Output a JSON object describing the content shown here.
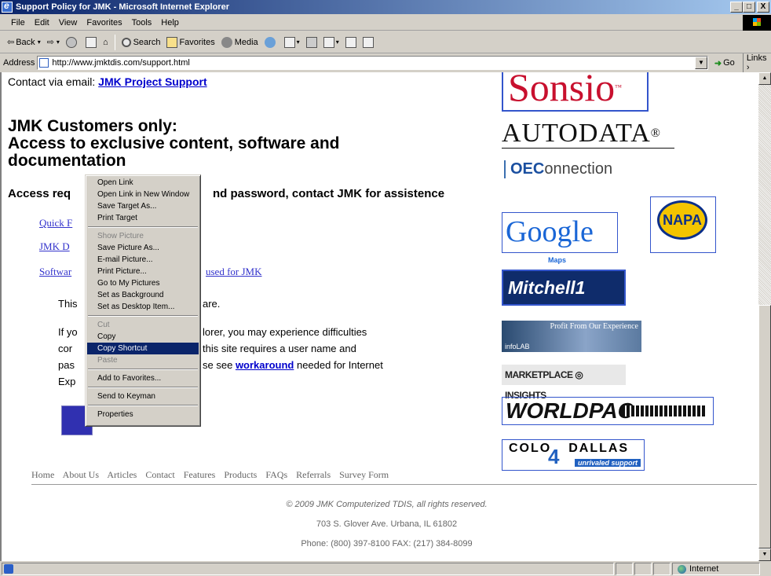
{
  "window": {
    "title": "Support Policy for JMK - Microsoft Internet Explorer",
    "controls": [
      "_",
      "□",
      "X"
    ]
  },
  "menu": [
    "File",
    "Edit",
    "View",
    "Favorites",
    "Tools",
    "Help"
  ],
  "toolbar": {
    "back": "Back",
    "search": "Search",
    "favorites": "Favorites",
    "media": "Media"
  },
  "address": {
    "label": "Address",
    "url": "http://www.jmktdis.com/support.html",
    "go": "Go",
    "links": "Links"
  },
  "page": {
    "contact_prefix": "Contact via email:",
    "contact_link": "JMK Project Support",
    "heading_line1": "JMK Customers only:",
    "heading_line2": "Access to exclusive content, software and",
    "heading_line3": "documentation",
    "subhead_left": "Access req",
    "subhead_right": "nd password, contact JMK for assistence",
    "links": [
      "Quick F",
      "JMK D",
      "Softwar"
    ],
    "link_fragment_right": "used for JMK",
    "para1_left": "This",
    "para1_right": "are.",
    "para2_rows": [
      {
        "left": "If yo",
        "right": "lorer, you may experience difficulties"
      },
      {
        "left": "cor",
        "right": "this site requires a user name and"
      },
      {
        "left": "pas",
        "right": "se see",
        "link": "workaround",
        "after": "needed for Internet"
      },
      {
        "left": "Exp",
        "right": ""
      }
    ]
  },
  "footer": {
    "nav": [
      "Home",
      "About Us",
      "Articles",
      "Contact",
      "Features",
      "Products",
      "FAQs",
      "Referrals",
      "Survey Form"
    ],
    "copyright": "© 2009 JMK Computerized TDIS, all rights reserved.",
    "address": "703 S. Glover Ave. Urbana, IL 61802",
    "phone": "Phone: (800) 397-8100 FAX: (217) 384-8099"
  },
  "logos": {
    "sonsio": "Sonsio",
    "autodata": "AUTODATA",
    "oec_bold": "OEC",
    "oec_rest": "onnection",
    "google": "Google",
    "google_maps": "Maps",
    "napa": "NAPA",
    "mitchell": "Mitchell1",
    "infolab_top": "Profit From Our Experience",
    "infolab_bottom": "infoLAB",
    "marketplace": "MARKETPLACE ◎ INSIGHTS",
    "worldpac": "WORLDPAC",
    "colo_top": "COLO",
    "colo_4": "4",
    "colo_right": "DALLAS",
    "colo_tag": "unrivaled support"
  },
  "context_menu": [
    {
      "label": "Open Link"
    },
    {
      "label": "Open Link in New Window"
    },
    {
      "label": "Save Target As..."
    },
    {
      "label": "Print Target"
    },
    {
      "sep": true
    },
    {
      "label": "Show Picture",
      "disabled": true
    },
    {
      "label": "Save Picture As..."
    },
    {
      "label": "E-mail Picture..."
    },
    {
      "label": "Print Picture..."
    },
    {
      "label": "Go to My Pictures"
    },
    {
      "label": "Set as Background"
    },
    {
      "label": "Set as Desktop Item..."
    },
    {
      "sep": true
    },
    {
      "label": "Cut",
      "disabled": true
    },
    {
      "label": "Copy"
    },
    {
      "label": "Copy Shortcut",
      "highlighted": true
    },
    {
      "label": "Paste",
      "disabled": true
    },
    {
      "sep": true
    },
    {
      "label": "Add to Favorites..."
    },
    {
      "sep": true
    },
    {
      "label": "Send to Keyman"
    },
    {
      "sep": true
    },
    {
      "label": "Properties"
    }
  ],
  "status": {
    "zone": "Internet"
  }
}
